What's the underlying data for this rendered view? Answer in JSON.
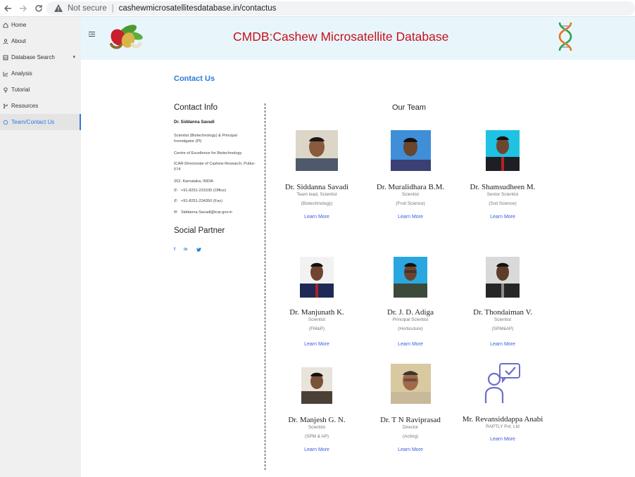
{
  "browser": {
    "security_label": "Not secure",
    "url": "cashewmicrosatellitesdatabase.in/contactus"
  },
  "sidebar": {
    "items": [
      {
        "label": "Home"
      },
      {
        "label": "About"
      },
      {
        "label": "Database Search"
      },
      {
        "label": "Analysis"
      },
      {
        "label": "Tutorial"
      },
      {
        "label": "Resources"
      },
      {
        "label": "Team/Contact Us"
      }
    ]
  },
  "header": {
    "title": "CMDB:Cashew Microsatellite Database"
  },
  "page": {
    "heading": "Contact Us"
  },
  "contact_info": {
    "title": "Contact Info",
    "name": "Dr. Siddanna Savadi",
    "lines": [
      "Scientist (Biotechnology) & Principal Investigator (PI)",
      "Centre of Excellence for Biotechnology",
      "ICAR-Directorate of Cashew Research, Puttur-574",
      "202, Karnataka, INDIA"
    ],
    "office_phone": "+91-8251-231530 (Office)",
    "fax": "+91-8251-234350 (Fax)",
    "email": "Siddanna.Savadi@icar.gov.in"
  },
  "social": {
    "title": "Social Partner",
    "links": [
      "f",
      "in",
      "t"
    ]
  },
  "team": {
    "title": "Our Team",
    "learn_more": "Learn More",
    "members": [
      {
        "name": "Dr. Siddanna Savadi",
        "role": "Team lead, Scientist",
        "dept": "(Biotechnology)"
      },
      {
        "name": "Dr. Muralidhara B.M.",
        "role": "Scientist",
        "dept": "(Fruit Science)"
      },
      {
        "name": "Dr. Shamsudheen M.",
        "role": "Senior Scientist",
        "dept": "(Soil Science)"
      },
      {
        "name": "Dr. Manjunath K.",
        "role": "Scientist",
        "dept": "(FM&P)"
      },
      {
        "name": "Dr. J. D. Adiga",
        "role": "Principal Scientist",
        "dept": "(Horticuture)"
      },
      {
        "name": "Dr. Thondaiman V.",
        "role": "Scientist",
        "dept": "(SPM&AP)"
      },
      {
        "name": "Dr. Manjesh G. N.",
        "role": "Scientist",
        "dept": "(SPM & AP)"
      },
      {
        "name": "Dr. T N Raviprasad",
        "role": "Director",
        "dept": "(Acting)"
      },
      {
        "name": "Mr. Revansiddappa Anabi",
        "role": "RAPTLY Pvt. Ltd",
        "dept": ""
      }
    ]
  },
  "colors": {
    "accent": "#2b7bd8",
    "title_red": "#c6111b",
    "header_bg": "#e8f6fb",
    "sidebar_bg": "#f0f0f0",
    "link": "#3b5bdb"
  }
}
